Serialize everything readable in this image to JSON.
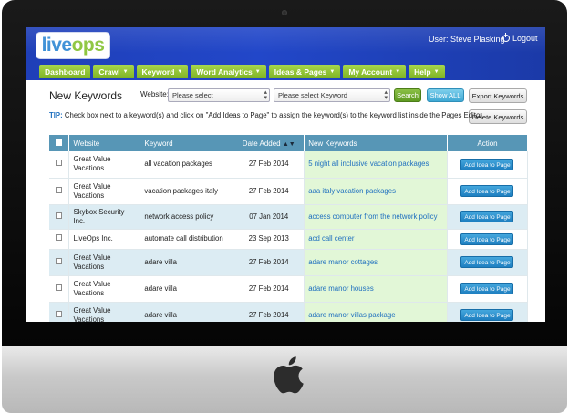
{
  "header": {
    "logo_part1": "live",
    "logo_part2": "ops",
    "welcome": "User: Steve Plasking",
    "logout": "Logout"
  },
  "nav": [
    {
      "label": "Dashboard",
      "caret": ""
    },
    {
      "label": "Crawl",
      "caret": "▼"
    },
    {
      "label": "Keyword",
      "caret": "▼"
    },
    {
      "label": "Word Analytics",
      "caret": "▼"
    },
    {
      "label": "Ideas & Pages",
      "caret": "▼"
    },
    {
      "label": "My Account",
      "caret": "▼"
    },
    {
      "label": "Help",
      "caret": "▼"
    }
  ],
  "page": {
    "title": "New Keywords",
    "website_label": "Website:",
    "website_select": "Please select",
    "keyword_select": "Please select Keyword",
    "search_button": "Search",
    "show_all_button": "Show ALL",
    "export_button": "Export Keywords",
    "delete_button": "Delete Keywords",
    "tip_label": "TIP:",
    "tip_text": " Check box next to a keyword(s) and click on \"Add Ideas to Page\" to assign the keyword(s) to the keyword list inside the Pages Editor."
  },
  "table": {
    "headers": {
      "website": "Website",
      "keyword": "Keyword",
      "date": "Date Added",
      "date_sort": "▲▼",
      "new_keywords": "New Keywords",
      "action": "Action"
    },
    "rows": [
      {
        "website": "Great Value Vacations",
        "keyword": "all vacation packages",
        "date": "27 Feb 2014",
        "new_keyword": "5 night all inclusive vacation packages",
        "action": "Add Idea to Page"
      },
      {
        "website": "Great Value Vacations",
        "keyword": "vacation packages italy",
        "date": "27 Feb 2014",
        "new_keyword": "aaa italy vacation packages",
        "action": "Add Idea to Page"
      },
      {
        "website": "Skybox Security Inc.",
        "keyword": "network access policy",
        "date": "07 Jan 2014",
        "new_keyword": "access computer from the network policy",
        "action": "Add Idea to Page"
      },
      {
        "website": "LiveOps Inc.",
        "keyword": "automate call distribution",
        "date": "23 Sep 2013",
        "new_keyword": "acd call center",
        "action": "Add Idea to Page"
      },
      {
        "website": "Great Value Vacations",
        "keyword": "adare villa",
        "date": "27 Feb 2014",
        "new_keyword": "adare manor cottages",
        "action": "Add Idea to Page"
      },
      {
        "website": "Great Value Vacations",
        "keyword": "adare villa",
        "date": "27 Feb 2014",
        "new_keyword": "adare manor houses",
        "action": "Add Idea to Page"
      },
      {
        "website": "Great Value Vacations",
        "keyword": "adare villa",
        "date": "27 Feb 2014",
        "new_keyword": "adare manor villas package",
        "action": "Add Idea to Page"
      }
    ]
  },
  "colors": {
    "header_blue": "#2247c9",
    "nav_green": "#8cc63f",
    "table_header": "#5796b6",
    "new_keyword_bg": "#e2f7d7",
    "link_blue": "#1e6fbf"
  }
}
